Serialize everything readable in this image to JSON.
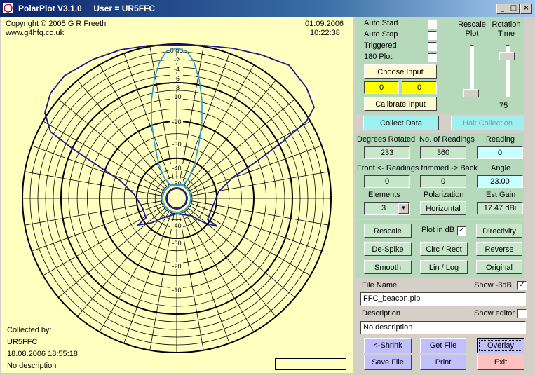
{
  "window": {
    "title": "PolarPlot V3.1.0     User = UR5FFC",
    "minimize": "_",
    "maximize": "□",
    "close": "×"
  },
  "plot": {
    "copyright": "Copyright © 2005 G R Freeth",
    "url": "www.g4hfq.co.uk",
    "date": "01.09.2006",
    "time": "10:22:38",
    "collected_by_label": "Collected by:",
    "collector": "UR5FFC",
    "collected_at": "18.08.2006 18:55:18",
    "description": "No description",
    "db_labels": [
      "0 dB",
      "-2",
      "-4",
      "-6",
      "-8",
      "-10",
      "-20",
      "-30",
      "-40",
      "-50"
    ],
    "db_labels_lower": [
      "-40",
      "-30",
      "-20",
      "-10"
    ],
    "colors": {
      "background": "#ffffc0",
      "grid": "#000000",
      "main_pattern": "#1a1a8c",
      "secondary_pattern": "#2a9ad8"
    }
  },
  "options": {
    "auto_start": "Auto Start",
    "auto_stop": "Auto Stop",
    "triggered": "Triggered",
    "plot180": "180 Plot",
    "choose_input": "Choose Input",
    "input_a": "0",
    "input_b": "0",
    "calibrate_input": "Calibrate Input",
    "rescale_plot": "Rescale Plot",
    "rotation_time": "Rotation Time",
    "rotation_value": "75"
  },
  "collect": {
    "collect_data": "Collect Data",
    "halt_collection": "Halt Collection"
  },
  "readings": {
    "degrees_rotated_label": "Degrees Rotated",
    "degrees_rotated": "233",
    "num_readings_label": "No. of Readings",
    "num_readings": "360",
    "reading_label": "Reading",
    "reading": "0",
    "trimmed_label": "Front <- Readings trimmed -> Back",
    "front": "0",
    "back": "0",
    "angle_label": "Angle",
    "angle": "23.00",
    "elements_label": "Elements",
    "elements": "3",
    "polarization_label": "Polarization",
    "polarization": "Horizontal",
    "est_gain_label": "Est Gain",
    "est_gain": "17.47 dBi"
  },
  "tools": {
    "rescale": "Rescale",
    "plot_in_db": "Plot in dB",
    "directivity": "Directivity",
    "despike": "De-Spike",
    "circ_rect": "Circ / Rect",
    "reverse": "Reverse",
    "smooth": "Smooth",
    "lin_log": "Lin / Log",
    "original": "Original"
  },
  "file": {
    "file_name_label": "File Name",
    "show_3db": "Show -3dB",
    "file_name": "FFC_beacon.plp",
    "description_label": "Description",
    "show_editor": "Show editor",
    "description": "No description",
    "shrink": "<-Shrink",
    "get_file": "Get File",
    "overlay": "Overlay",
    "save_file": "Save File",
    "print": "Print",
    "exit": "Exit"
  }
}
